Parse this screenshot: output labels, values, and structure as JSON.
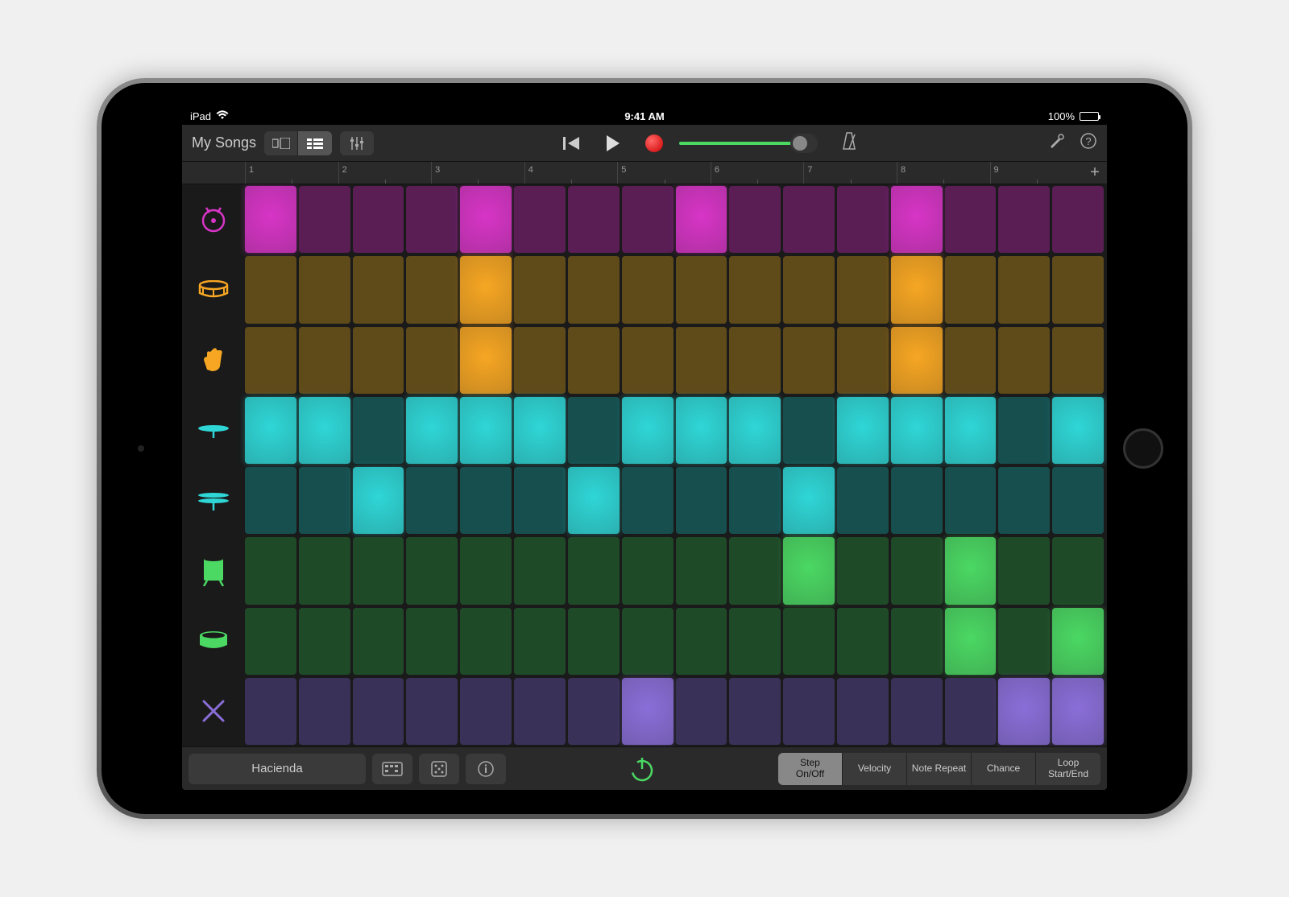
{
  "status": {
    "device": "iPad",
    "time": "9:41 AM",
    "battery": "100%"
  },
  "toolbar": {
    "my_songs": "My Songs"
  },
  "ruler": {
    "bars": [
      "1",
      "2",
      "3",
      "4",
      "5",
      "6",
      "7",
      "8",
      "9"
    ]
  },
  "instruments": [
    {
      "name": "kick",
      "color": "#d735c6",
      "dim": "#5a1e55"
    },
    {
      "name": "snare",
      "color": "#f6a623",
      "dim": "#5f4a1a"
    },
    {
      "name": "clap",
      "color": "#f6a623",
      "dim": "#5f4a1a"
    },
    {
      "name": "closed-hihat",
      "color": "#2fd6d6",
      "dim": "#174f4f"
    },
    {
      "name": "open-hihat",
      "color": "#2fd6d6",
      "dim": "#174f4f"
    },
    {
      "name": "tom-high",
      "color": "#4bd863",
      "dim": "#1f4a28"
    },
    {
      "name": "tom-low",
      "color": "#4bd863",
      "dim": "#1f4a28"
    },
    {
      "name": "sticks",
      "color": "#8a6ed8",
      "dim": "#3a3158"
    }
  ],
  "steps": [
    [
      1,
      0,
      0,
      0,
      1,
      0,
      0,
      0,
      1,
      0,
      0,
      0,
      1,
      0,
      0,
      0
    ],
    [
      0,
      0,
      0,
      0,
      1,
      0,
      0,
      0,
      0,
      0,
      0,
      0,
      1,
      0,
      0,
      0
    ],
    [
      0,
      0,
      0,
      0,
      1,
      0,
      0,
      0,
      0,
      0,
      0,
      0,
      1,
      0,
      0,
      0
    ],
    [
      1,
      1,
      0,
      1,
      1,
      1,
      0,
      1,
      1,
      1,
      0,
      1,
      1,
      1,
      0,
      1
    ],
    [
      0,
      0,
      1,
      0,
      0,
      0,
      1,
      0,
      0,
      0,
      1,
      0,
      0,
      0,
      0,
      0
    ],
    [
      0,
      0,
      0,
      0,
      0,
      0,
      0,
      0,
      0,
      0,
      1,
      0,
      0,
      1,
      0,
      0
    ],
    [
      0,
      0,
      0,
      0,
      0,
      0,
      0,
      0,
      0,
      0,
      0,
      0,
      0,
      1,
      0,
      1
    ],
    [
      0,
      0,
      0,
      0,
      0,
      0,
      0,
      1,
      0,
      0,
      0,
      0,
      0,
      0,
      1,
      1
    ]
  ],
  "bottom": {
    "preset": "Hacienda",
    "modes": [
      "Step\nOn/Off",
      "Velocity",
      "Note Repeat",
      "Chance",
      "Loop\nStart/End"
    ],
    "selected_mode": 0
  }
}
